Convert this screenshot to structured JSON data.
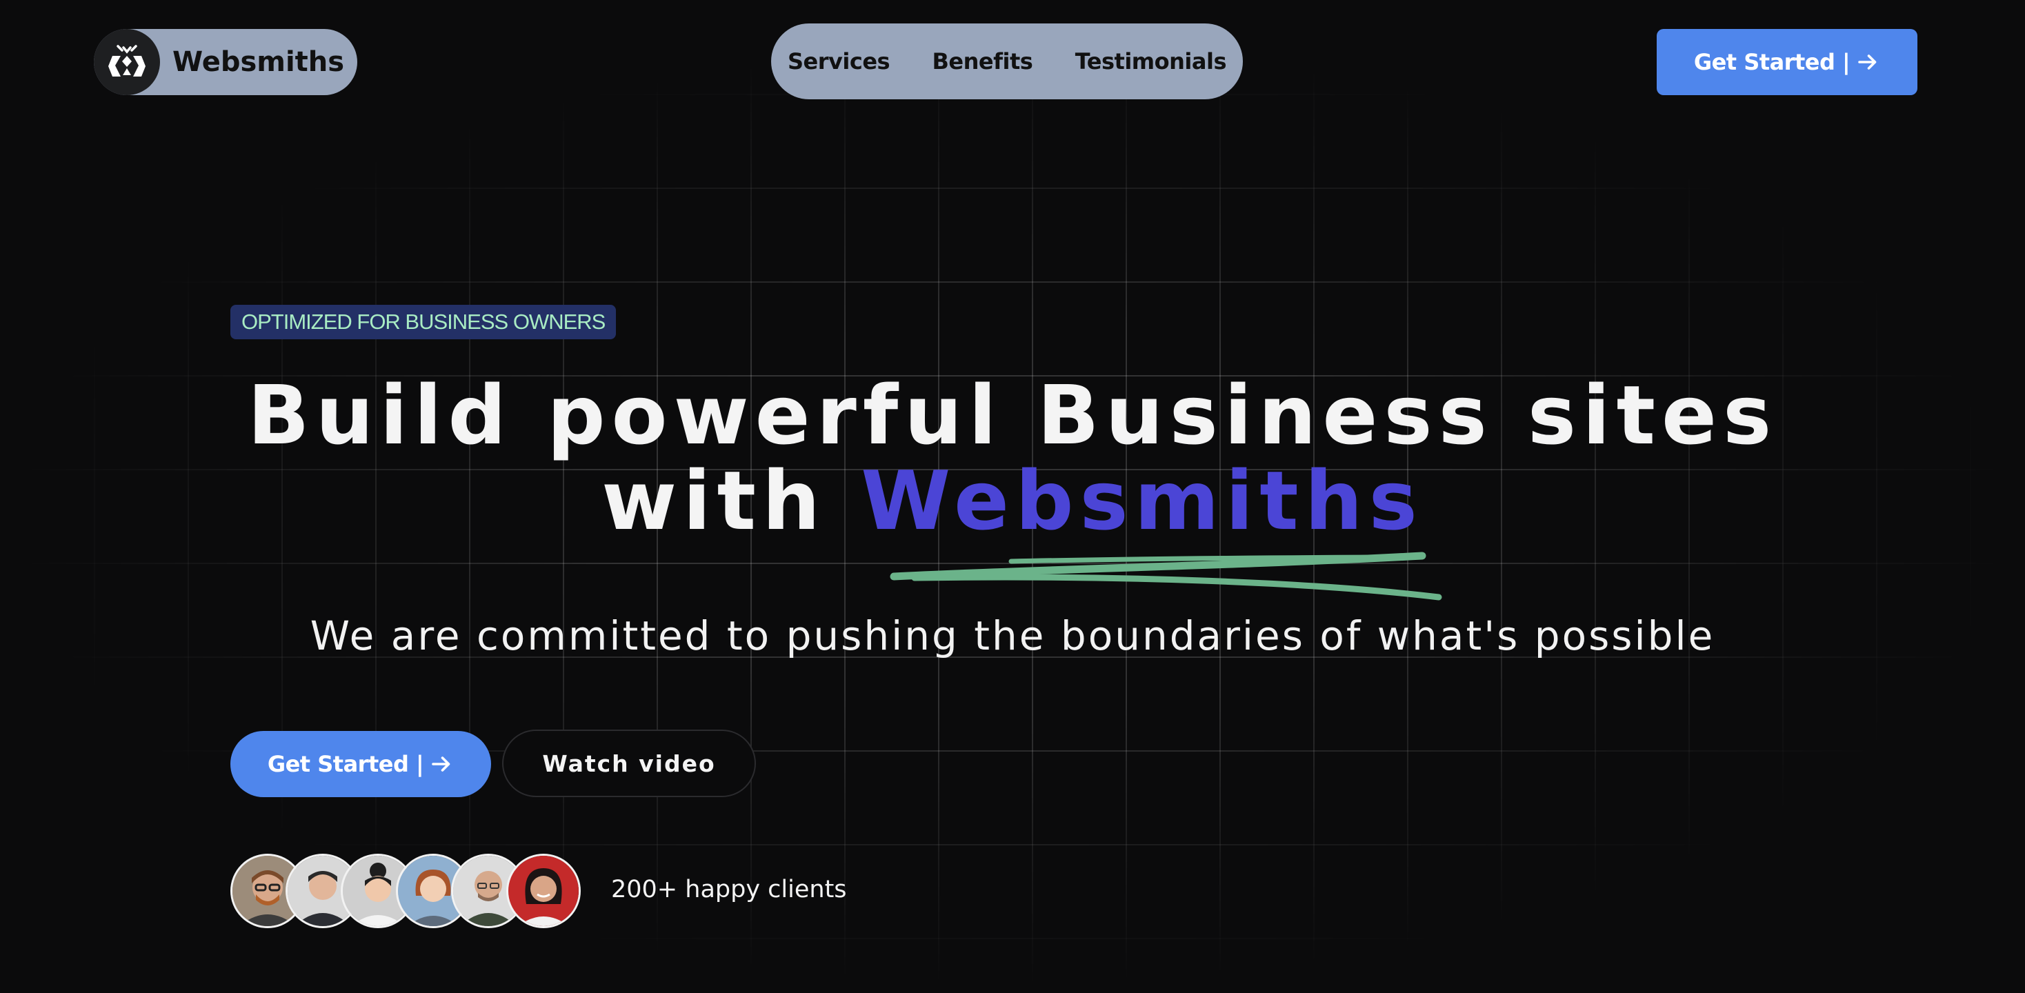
{
  "header": {
    "brand_name": "Websmiths",
    "nav": [
      "Services",
      "Benefits",
      "Testimonials"
    ],
    "cta_label": "Get Started |"
  },
  "hero": {
    "badge": "OPTIMIZED FOR BUSINESS OWNERS",
    "headline_line1": "Build powerful Business sites",
    "headline_with": "with",
    "headline_accent": "Websmiths",
    "subtitle": "We are committed to pushing the boundaries of what's possible",
    "primary_cta": "Get Started |",
    "secondary_cta": "Watch video",
    "clients_text": "200+ happy clients"
  },
  "avatars": [
    "client-1",
    "client-2",
    "client-3",
    "client-4",
    "client-5",
    "client-6"
  ],
  "colors": {
    "background": "#0b0b0c",
    "pill": "#99a6bc",
    "primary": "#4f86ec",
    "accent": "#4b45d6",
    "badge_bg": "#233066",
    "badge_text": "#a9ecc3",
    "scribble": "#6bb38a"
  },
  "icons": {
    "logo": "websmiths-logo-icon",
    "arrow": "arrow-right-icon"
  }
}
